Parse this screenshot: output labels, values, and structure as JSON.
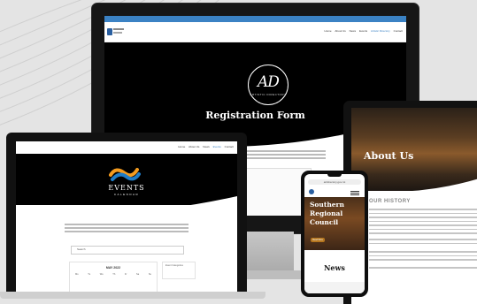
{
  "monitor": {
    "nav_items": [
      "Home",
      "About Us",
      "News",
      "Events",
      "Artistic Directory",
      "Contact"
    ],
    "logo_initials": "AD",
    "logo_subtitle": "ARTISTIC DIRECTORY",
    "page_title": "Registration Form"
  },
  "laptop_left": {
    "nav_items": [
      "Home",
      "About Us",
      "News",
      "Events",
      "Contact"
    ],
    "logo_title": "EVENTS",
    "logo_subtitle": "CALENDAR",
    "search_placeholder": "Search",
    "calendar_month": "MAY 2022",
    "weekdays": [
      "Mo",
      "Tu",
      "We",
      "Th",
      "Fr",
      "Sa",
      "Su"
    ],
    "side_box_label": "Event Categories"
  },
  "laptop_right": {
    "hero_title": "About Us",
    "section_title": "OUR HISTORY"
  },
  "phone": {
    "url": "artdirectory.gov.mt",
    "hero_title": "Southern Regional Council",
    "button_label": "Read More",
    "section_title": "News"
  },
  "colors": {
    "accent_blue": "#3b82c4",
    "events_orange": "#f39b1f",
    "events_blue": "#1f7cc6",
    "gold_button": "#b5761e"
  }
}
